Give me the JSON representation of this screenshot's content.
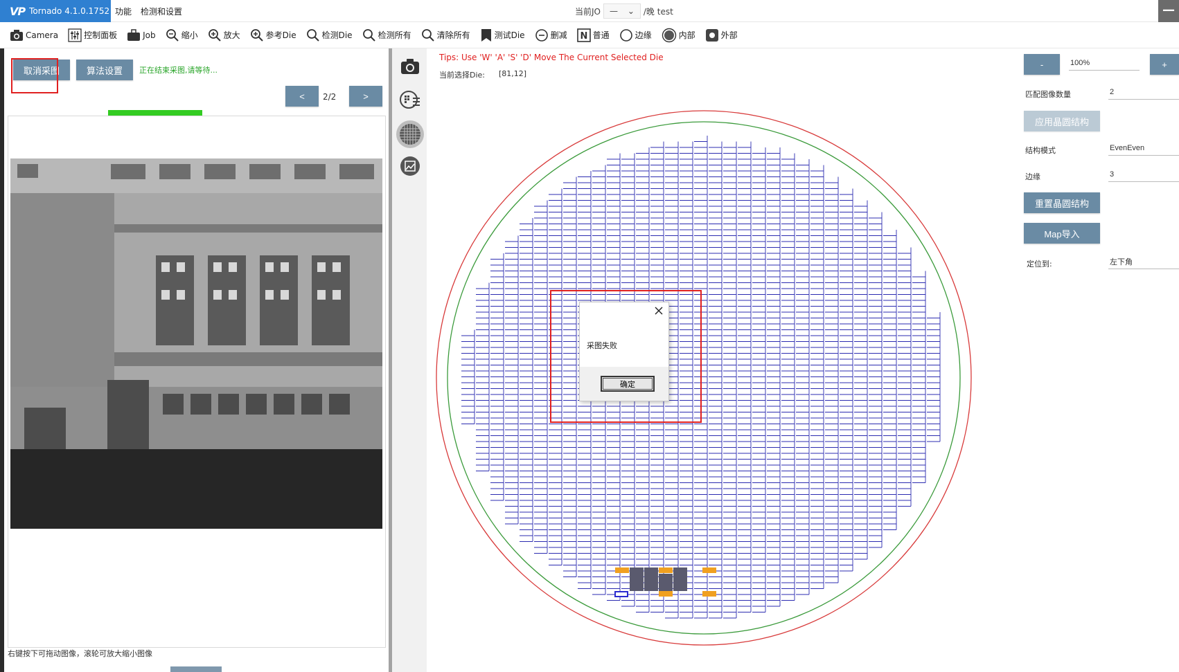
{
  "titlebar": {
    "app_name": "Tornado 4.1.0.1752",
    "menu_functions": "功能",
    "menu_detect_settings": "检测和设置",
    "job_prefix": "当前JO",
    "job_dash": "—",
    "job_suffix": "/晚 test",
    "min_symbol": "—"
  },
  "toolbar": {
    "items": [
      {
        "label": "Camera",
        "icon": "camera-icon"
      },
      {
        "label": "控制面板",
        "icon": "sliders-icon"
      },
      {
        "label": "Job",
        "icon": "briefcase-icon"
      },
      {
        "label": "缩小",
        "icon": "zoom-out-icon"
      },
      {
        "label": "放大",
        "icon": "zoom-in-icon"
      },
      {
        "label": "参考Die",
        "icon": "reference-die-icon"
      },
      {
        "label": "检测Die",
        "icon": "search-icon"
      },
      {
        "label": "检测所有",
        "icon": "search-icon"
      },
      {
        "label": "清除所有",
        "icon": "search-icon"
      },
      {
        "label": "测试Die",
        "icon": "bookmark-icon"
      },
      {
        "label": "删减",
        "icon": "minus-circle-icon"
      },
      {
        "label": "普通",
        "icon": "n-box-icon"
      },
      {
        "label": "边缘",
        "icon": "circle-outline-icon"
      },
      {
        "label": "内部",
        "icon": "circle-filled-icon"
      },
      {
        "label": "外部",
        "icon": "square-dot-icon"
      }
    ]
  },
  "left": {
    "cancel_capture": "取消采图",
    "algo_settings": "算法设置",
    "status": "正在结束采图,请等待...",
    "prev": "<",
    "next": ">",
    "page": "2/2",
    "hint": "右键按下可拖动图像，滚轮可放大缩小图像"
  },
  "center": {
    "tips": "Tips: Use 'W' 'A' 'S' 'D' Move The Current Selected Die",
    "selected_die_label": "当前选择Die:",
    "selected_die_value": "[81,12]"
  },
  "dialog": {
    "message": "采图失败",
    "ok": "确定"
  },
  "right": {
    "zoom_out": "-",
    "zoom_value": "100%",
    "zoom_in": "+",
    "match_count_label": "匹配图像数量",
    "match_count_value": "2",
    "apply_structure": "应用晶圆结构",
    "structure_mode_label": "结构模式",
    "structure_mode_value": "EvenEven",
    "edge_label": "边缘",
    "edge_value": "3",
    "reset_structure": "重置晶圆结构",
    "map_import": "Map导入",
    "locate_label": "定位到:",
    "locate_value": "左下角"
  },
  "colors": {
    "brand_blue": "#2f80d1",
    "button_blue": "#6a8ba4",
    "die_grid": "#2b2bb0",
    "wafer_outer": "#d83a3a",
    "wafer_inner": "#3a9a3a",
    "highlight_orange": "#f0a020",
    "tips_red": "#e02020",
    "status_green": "#2aa52a"
  }
}
